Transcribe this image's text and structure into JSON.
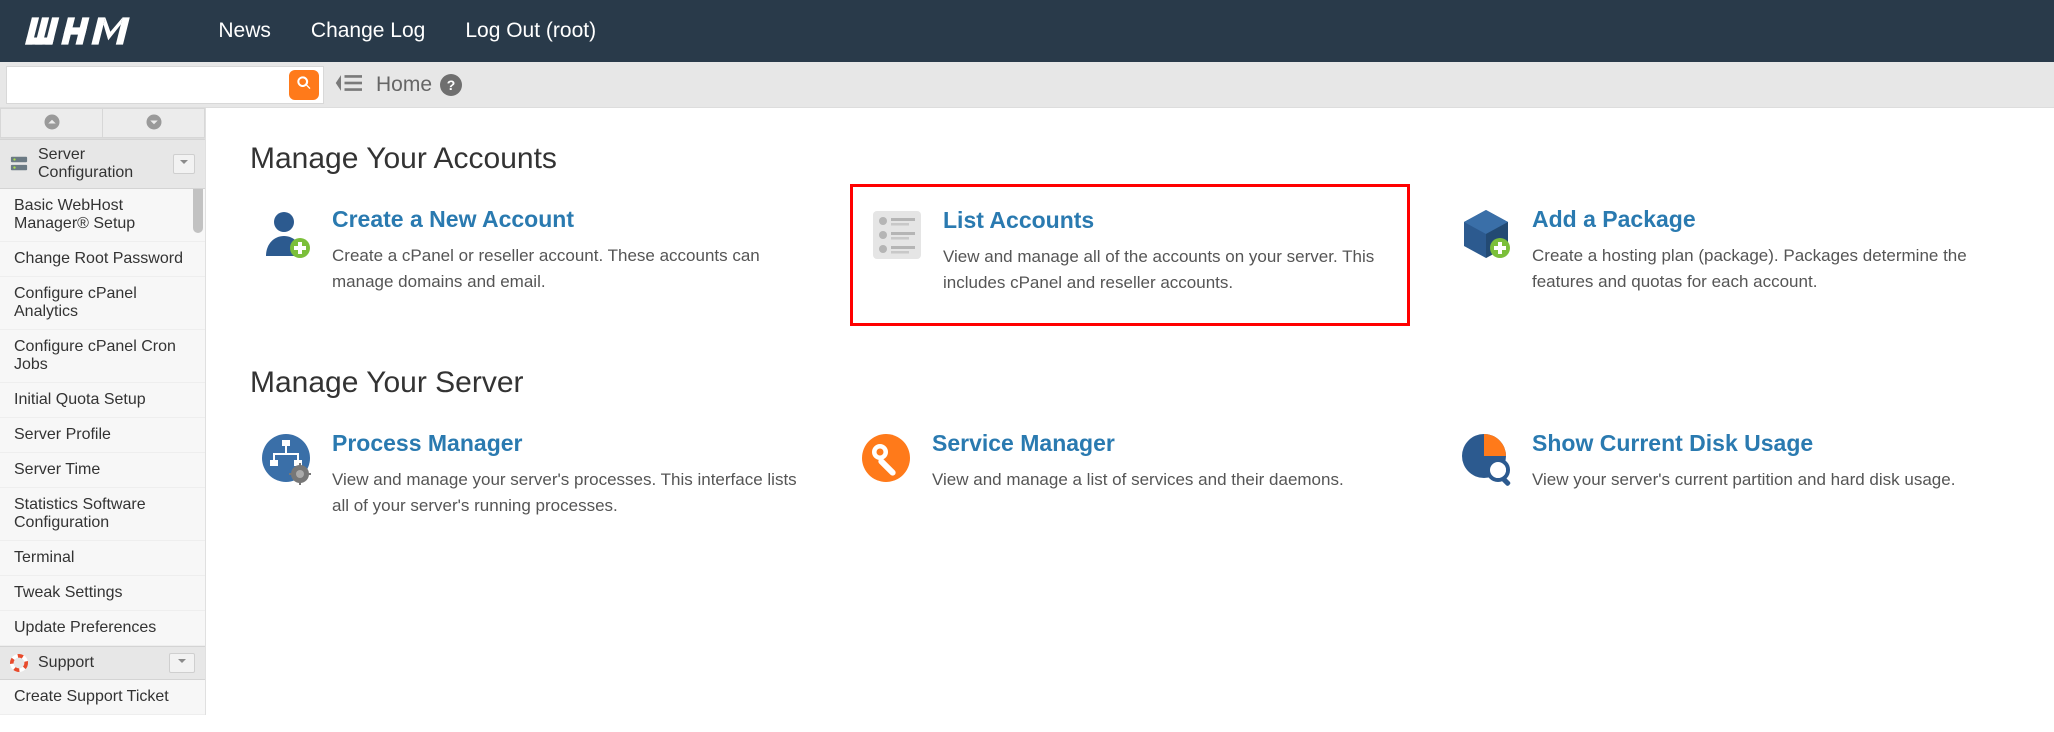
{
  "topnav": {
    "links": [
      "News",
      "Change Log",
      "Log Out (root)"
    ]
  },
  "search": {
    "placeholder": ""
  },
  "breadcrumb": "Home",
  "sidebar": {
    "groups": [
      {
        "name": "Server Configuration",
        "items": [
          "Basic WebHost Manager® Setup",
          "Change Root Password",
          "Configure cPanel Analytics",
          "Configure cPanel Cron Jobs",
          "Initial Quota Setup",
          "Server Profile",
          "Server Time",
          "Statistics Software Configuration",
          "Terminal",
          "Tweak Settings",
          "Update Preferences"
        ]
      },
      {
        "name": "Support",
        "items": [
          "Create Support Ticket"
        ]
      }
    ]
  },
  "sections": [
    {
      "title": "Manage Your Accounts",
      "cards": [
        {
          "title": "Create a New Account",
          "desc": "Create a cPanel or reseller account. These accounts can manage domains and email."
        },
        {
          "title": "List Accounts",
          "desc": "View and manage all of the accounts on your server. This includes cPanel and reseller accounts.",
          "highlight": true
        },
        {
          "title": "Add a Package",
          "desc": "Create a hosting plan (package). Packages determine the features and quotas for each account."
        }
      ]
    },
    {
      "title": "Manage Your Server",
      "cards": [
        {
          "title": "Process Manager",
          "desc": "View and manage your server's processes. This interface lists all of your server's running processes."
        },
        {
          "title": "Service Manager",
          "desc": "View and manage a list of services and their daemons."
        },
        {
          "title": "Show Current Disk Usage",
          "desc": "View your server's current partition and hard disk usage."
        }
      ]
    }
  ]
}
